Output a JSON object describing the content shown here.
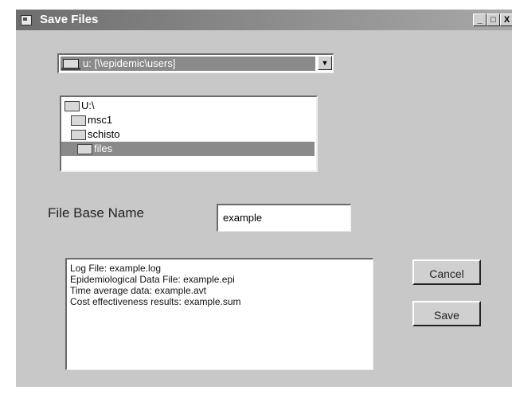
{
  "window": {
    "title": "Save Files",
    "controls": [
      "_",
      "□",
      "X"
    ]
  },
  "drive": {
    "selected": "u: [\\\\epidemic\\users]"
  },
  "folders": [
    {
      "label": "U:\\",
      "selected": false
    },
    {
      "label": "msc1",
      "selected": false
    },
    {
      "label": "schisto",
      "selected": false
    },
    {
      "label": "files",
      "selected": true
    }
  ],
  "base_name": {
    "label": "File Base Name",
    "value": "example"
  },
  "output_files": [
    "Log File: example.log",
    "Epidemiological Data File: example.epi",
    "Time average data: example.avt",
    "Cost effectiveness results: example.sum"
  ],
  "buttons": {
    "cancel": "Cancel",
    "save": "Save"
  }
}
